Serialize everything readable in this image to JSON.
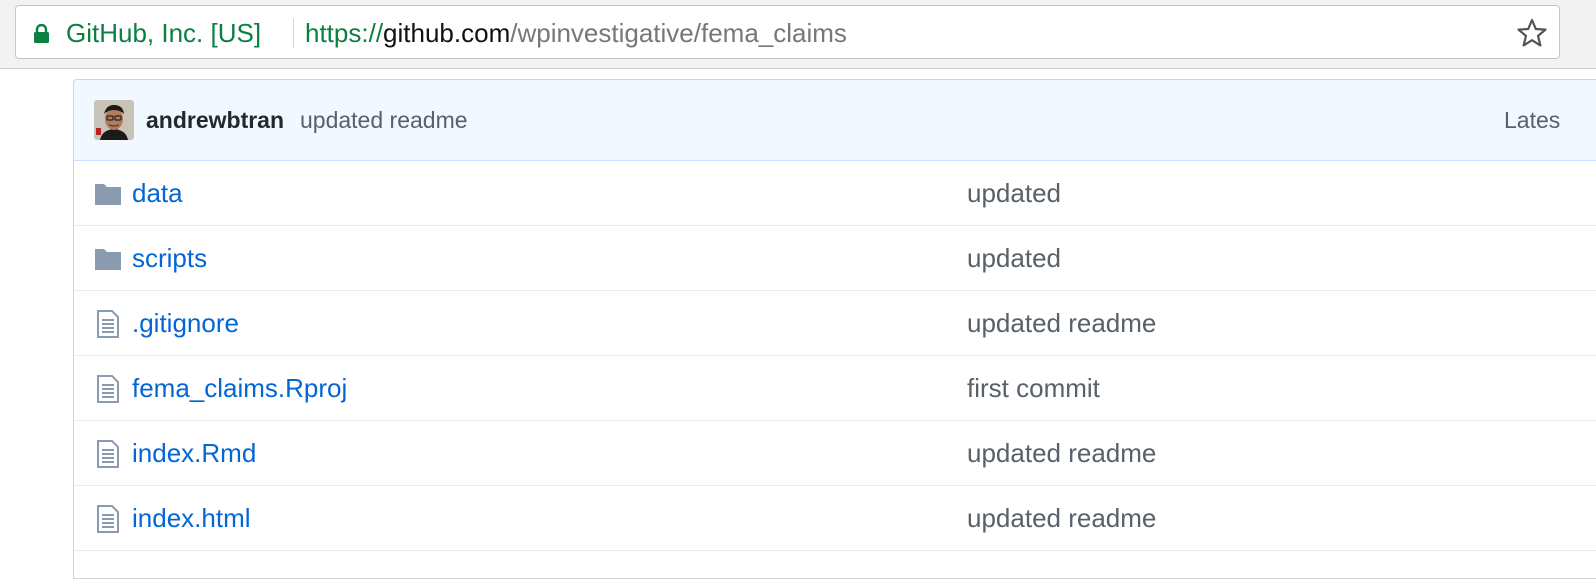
{
  "browser": {
    "security_label": "GitHub, Inc. [US]",
    "url_scheme": "https://",
    "url_host": "github.com",
    "url_path": "/wpinvestigative/fema_claims",
    "lock_icon": "lock-icon",
    "star_icon": "star-icon",
    "secure_color": "#0b8043"
  },
  "commit": {
    "author": "andrewbtran",
    "message": "updated readme",
    "latest_label": "Lates"
  },
  "files": [
    {
      "name": "data",
      "message": "updated",
      "icon": "folder-icon"
    },
    {
      "name": "scripts",
      "message": "updated",
      "icon": "folder-icon"
    },
    {
      "name": ".gitignore",
      "message": "updated readme",
      "icon": "file-icon"
    },
    {
      "name": "fema_claims.Rproj",
      "message": "first commit",
      "icon": "file-icon"
    },
    {
      "name": "index.Rmd",
      "message": "updated readme",
      "icon": "file-icon"
    },
    {
      "name": "index.html",
      "message": "updated readme",
      "icon": "file-icon"
    }
  ],
  "colors": {
    "link": "#0366d6",
    "commit_bg": "#f1f8ff",
    "folder": "#8a9bb0"
  }
}
